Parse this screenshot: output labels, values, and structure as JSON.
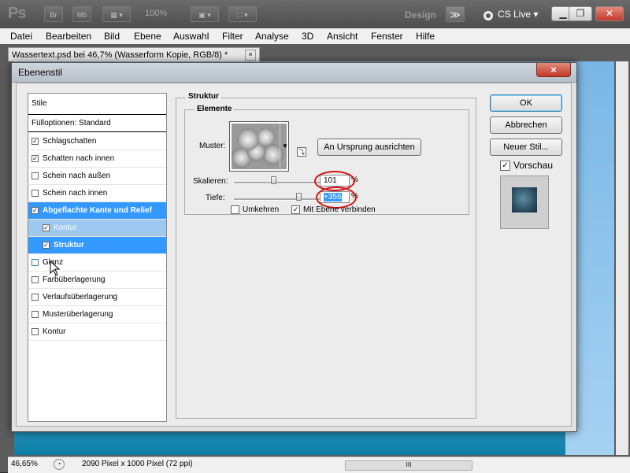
{
  "app": {
    "logo": "Ps",
    "zoom": "100%",
    "workspace": "Design",
    "cslive": "CS Live"
  },
  "toolbar": {
    "br": "Br",
    "mb": "Mb",
    "more": "≫"
  },
  "menu": [
    "Datei",
    "Bearbeiten",
    "Bild",
    "Ebene",
    "Auswahl",
    "Filter",
    "Analyse",
    "3D",
    "Ansicht",
    "Fenster",
    "Hilfe"
  ],
  "document": {
    "tab_title": "Wassertext.psd bei 46,7% (Wasserform Kopie, RGB/8) *",
    "close": "×"
  },
  "status": {
    "zoom": "46,65%",
    "info": "2090 Pixel x 1000 Pixel (72 ppi)",
    "scroll_grip": "III"
  },
  "dialog": {
    "title": "Ebenenstil",
    "close": "×",
    "style_list": {
      "header": "Stile",
      "fill_options": "Fülloptionen: Standard",
      "items": [
        {
          "label": "Schlagschatten",
          "checked": true
        },
        {
          "label": "Schatten nach innen",
          "checked": true
        },
        {
          "label": "Schein nach außen",
          "checked": false
        },
        {
          "label": "Schein nach innen",
          "checked": false
        },
        {
          "label": "Abgeflachte Kante und Relief",
          "checked": true
        },
        {
          "label": "Kontur",
          "checked": true
        },
        {
          "label": "Struktur",
          "checked": true
        },
        {
          "label": "Glanz",
          "checked": false
        },
        {
          "label": "Farbüberlagerung",
          "checked": false
        },
        {
          "label": "Verlaufsüberlagerung",
          "checked": false
        },
        {
          "label": "Musterüberlagerung",
          "checked": false
        },
        {
          "label": "Kontur",
          "checked": false
        }
      ]
    },
    "structure": {
      "title": "Struktur",
      "group": "Elemente",
      "pattern_label": "Muster:",
      "snap_button": "An Ursprung ausrichten",
      "scale_label": "Skalieren:",
      "scale_value": "101",
      "scale_unit": "%",
      "depth_label": "Tiefe:",
      "depth_value": "+356",
      "depth_unit": "%",
      "invert_label": "Umkehren",
      "invert_checked": false,
      "link_label": "Mit Ebene verbinden",
      "link_checked": true
    },
    "buttons": {
      "ok": "OK",
      "cancel": "Abbrechen",
      "new_style": "Neuer Stil..."
    },
    "preview": {
      "label": "Vorschau",
      "checked": true
    }
  },
  "check": "✓"
}
